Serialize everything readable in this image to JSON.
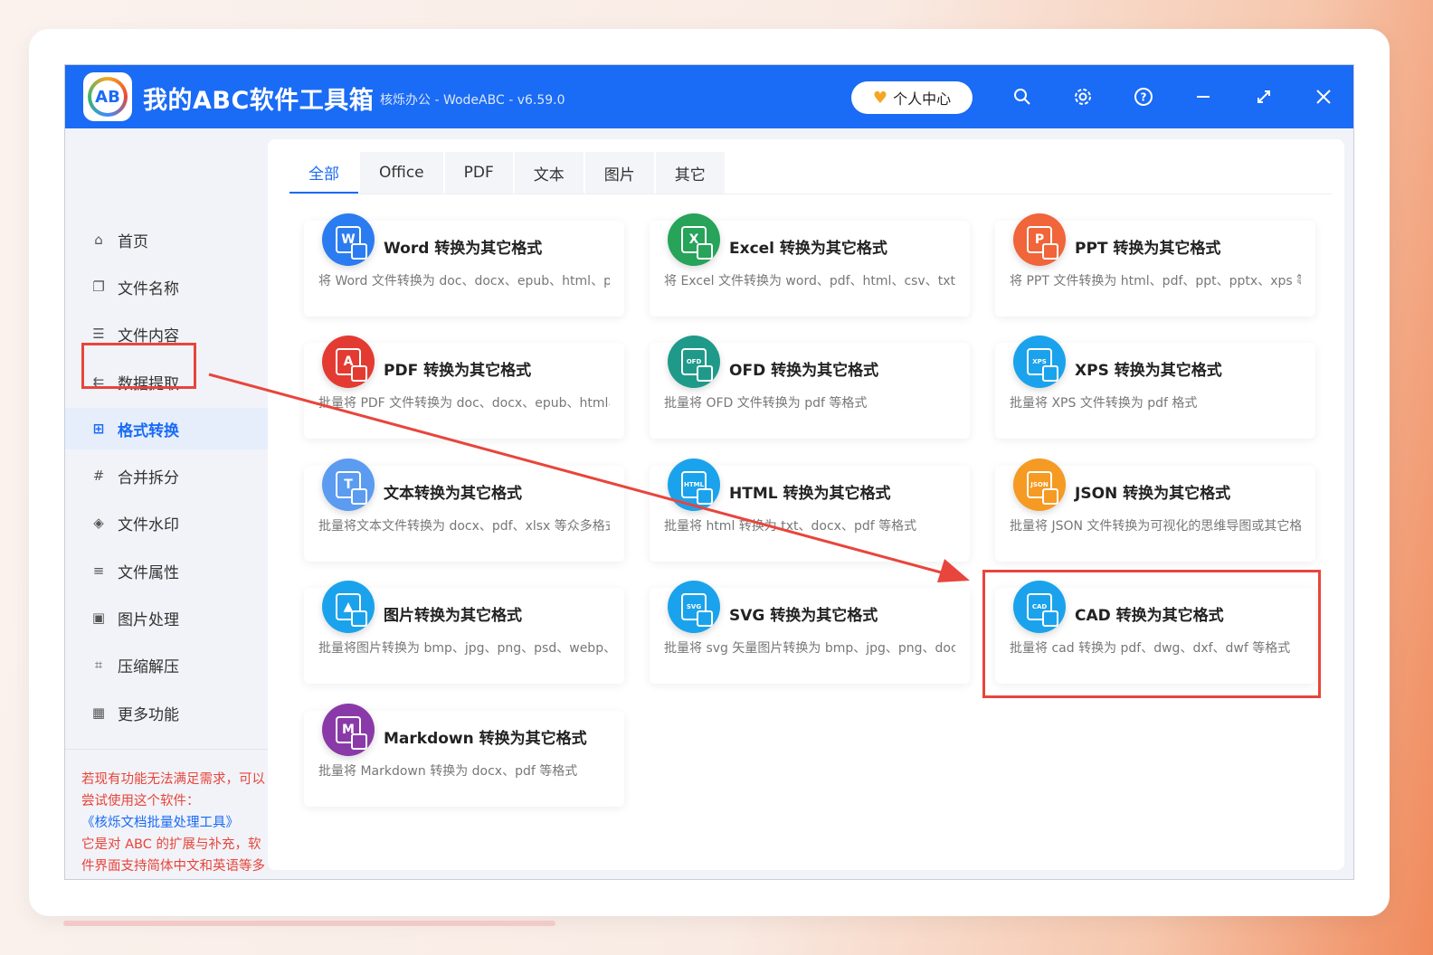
{
  "app": {
    "logo_text": "AB",
    "title": "我的ABC软件工具箱",
    "subtitle": "核烁办公 - WodeABC - v6.59.0",
    "user_center": "个人中心",
    "window_controls": [
      "search-icon",
      "gear-icon",
      "help-icon",
      "minimize-icon",
      "maximize-icon",
      "close-icon"
    ]
  },
  "sidebar": {
    "items": [
      {
        "label": "首页",
        "icon": "home-icon"
      },
      {
        "label": "文件名称",
        "icon": "file-icon"
      },
      {
        "label": "文件内容",
        "icon": "list-icon"
      },
      {
        "label": "数据提取",
        "icon": "extract-icon"
      },
      {
        "label": "格式转换",
        "icon": "convert-icon",
        "active": true
      },
      {
        "label": "合并拆分",
        "icon": "hash-icon"
      },
      {
        "label": "文件水印",
        "icon": "shield-icon"
      },
      {
        "label": "文件属性",
        "icon": "properties-icon"
      },
      {
        "label": "图片处理",
        "icon": "image-icon"
      },
      {
        "label": "压缩解压",
        "icon": "compress-icon"
      },
      {
        "label": "更多功能",
        "icon": "grid-icon"
      }
    ],
    "note": {
      "line1": "若现有功能无法满足需求，可以尝试使用这个软件：",
      "link": "《核烁文档批量处理工具》",
      "line2": "它是对 ABC 的扩展与补充，软件界面支持简体中文和英语等多种语言、支持任务流连续处理，并且会经常更新！"
    }
  },
  "tabs": [
    "全部",
    "Office",
    "PDF",
    "文本",
    "图片",
    "其它"
  ],
  "active_tab": "全部",
  "cards": [
    {
      "title": "Word 转换为其它格式",
      "desc": "将 Word 文件转换为 doc、docx、epub、html、pd",
      "icon": "word-icon",
      "glyph": "W",
      "color": "#2b7cf0"
    },
    {
      "title": "Excel 转换为其它格式",
      "desc": "将 Excel 文件转换为 word、pdf、html、csv、txt、:",
      "icon": "excel-icon",
      "glyph": "X",
      "color": "#27a35a"
    },
    {
      "title": "PPT 转换为其它格式",
      "desc": "将 PPT 文件转换为 html、pdf、ppt、pptx、xps 等;",
      "icon": "ppt-icon",
      "glyph": "P",
      "color": "#f0653a"
    },
    {
      "title": "PDF 转换为其它格式",
      "desc": "批量将 PDF 文件转换为 doc、docx、epub、html、",
      "icon": "pdf-icon",
      "glyph": "A",
      "color": "#e33b32"
    },
    {
      "title": "OFD 转换为其它格式",
      "desc": "批量将 OFD 文件转换为 pdf 等格式",
      "icon": "ofd-icon",
      "glyph": "OFD",
      "color": "#1f9a8a"
    },
    {
      "title": "XPS 转换为其它格式",
      "desc": "批量将 XPS 文件转换为 pdf 格式",
      "icon": "xps-icon",
      "glyph": "XPS",
      "color": "#1aa3ec"
    },
    {
      "title": "文本转换为其它格式",
      "desc": "批量将文本文件转换为 docx、pdf、xlsx 等众多格式",
      "icon": "text-icon",
      "glyph": "T",
      "color": "#5b9bf0"
    },
    {
      "title": "HTML 转换为其它格式",
      "desc": "批量将 html 转换为 txt、docx、pdf 等格式",
      "icon": "html-icon",
      "glyph": "HTML",
      "color": "#1aa3ec"
    },
    {
      "title": "JSON 转换为其它格式",
      "desc": "批量将 JSON 文件转换为可视化的思维导图或其它格",
      "icon": "json-icon",
      "glyph": "JSON",
      "color": "#f59a23"
    },
    {
      "title": "图片转换为其它格式",
      "desc": "批量将图片转换为 bmp、jpg、png、psd、webp、",
      "icon": "image-convert-icon",
      "glyph": "▲",
      "color": "#1aa3ec"
    },
    {
      "title": "SVG 转换为其它格式",
      "desc": "批量将 svg 矢量图片转换为 bmp、jpg、png、doc:",
      "icon": "svg-icon",
      "glyph": "SVG",
      "color": "#1aa3ec"
    },
    {
      "title": "CAD 转换为其它格式",
      "desc": "批量将 cad 转换为 pdf、dwg、dxf、dwf 等格式",
      "icon": "cad-icon",
      "glyph": "CAD",
      "color": "#1aa3ec"
    },
    {
      "title": "Markdown 转换为其它格式",
      "desc": "批量将 Markdown 转换为 docx、pdf 等格式",
      "icon": "markdown-icon",
      "glyph": "M",
      "color": "#8a3aa8"
    }
  ],
  "annotation": {
    "color": "#e8453c"
  }
}
